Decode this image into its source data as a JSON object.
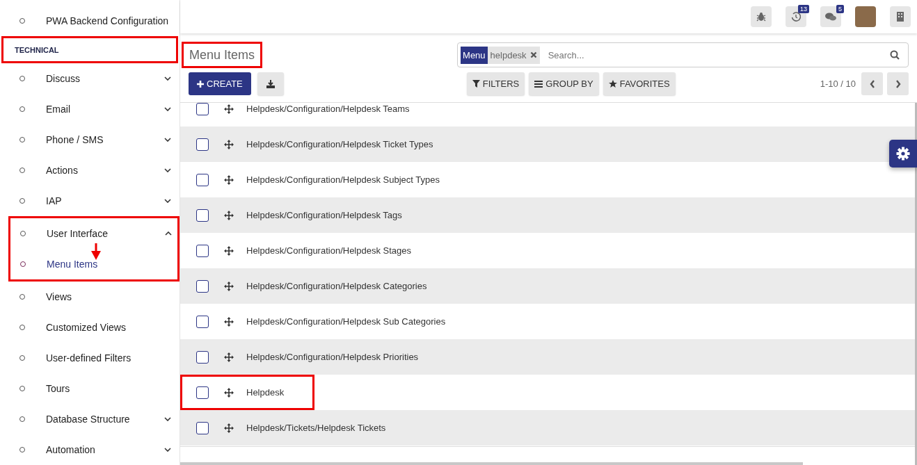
{
  "sidebar": {
    "items": [
      {
        "label": "PWA Backend Configuration",
        "kind": "leaf"
      },
      {
        "label": "TECHNICAL",
        "kind": "header",
        "highlighted": true
      },
      {
        "label": "Discuss",
        "kind": "folder",
        "expanded": false
      },
      {
        "label": "Email",
        "kind": "folder",
        "expanded": false
      },
      {
        "label": "Phone / SMS",
        "kind": "folder",
        "expanded": false
      },
      {
        "label": "Actions",
        "kind": "folder",
        "expanded": false
      },
      {
        "label": "IAP",
        "kind": "folder",
        "expanded": false
      },
      {
        "label": "User Interface",
        "kind": "folder",
        "expanded": true,
        "highlighted": true,
        "children": [
          {
            "label": "Menu Items",
            "selected": true,
            "arrow": true
          }
        ]
      },
      {
        "label": "Views",
        "kind": "leaf"
      },
      {
        "label": "Customized Views",
        "kind": "leaf"
      },
      {
        "label": "User-defined Filters",
        "kind": "leaf"
      },
      {
        "label": "Tours",
        "kind": "leaf"
      },
      {
        "label": "Database Structure",
        "kind": "folder",
        "expanded": false
      },
      {
        "label": "Automation",
        "kind": "folder",
        "expanded": false
      }
    ]
  },
  "topbar": {
    "activity_count": "13",
    "message_count": "5"
  },
  "page": {
    "title": "Menu Items",
    "title_highlighted": true,
    "create": "CREATE",
    "search": {
      "facet_label": "Menu",
      "facet_value": "helpdesk",
      "placeholder": "Search..."
    },
    "filters": [
      "FILTERS",
      "GROUP BY",
      "FAVORITES"
    ],
    "pager": "1-10 / 10"
  },
  "table": {
    "rows": [
      {
        "name": "Helpdesk/Configuration/Helpdesk Teams",
        "checked": false,
        "highlighted": false
      },
      {
        "name": "Helpdesk/Configuration/Helpdesk Ticket Types",
        "checked": false,
        "highlighted": false
      },
      {
        "name": "Helpdesk/Configuration/Helpdesk Subject Types",
        "checked": false,
        "highlighted": false
      },
      {
        "name": "Helpdesk/Configuration/Helpdesk Tags",
        "checked": false,
        "highlighted": false
      },
      {
        "name": "Helpdesk/Configuration/Helpdesk Stages",
        "checked": false,
        "highlighted": false
      },
      {
        "name": "Helpdesk/Configuration/Helpdesk Categories",
        "checked": false,
        "highlighted": false
      },
      {
        "name": "Helpdesk/Configuration/Helpdesk Sub Categories",
        "checked": false,
        "highlighted": false
      },
      {
        "name": "Helpdesk/Configuration/Helpdesk Priorities",
        "checked": false,
        "highlighted": false
      },
      {
        "name": "Helpdesk",
        "checked": false,
        "highlighted": true
      },
      {
        "name": "Helpdesk/Tickets/Helpdesk Tickets",
        "checked": false,
        "highlighted": false
      }
    ]
  }
}
